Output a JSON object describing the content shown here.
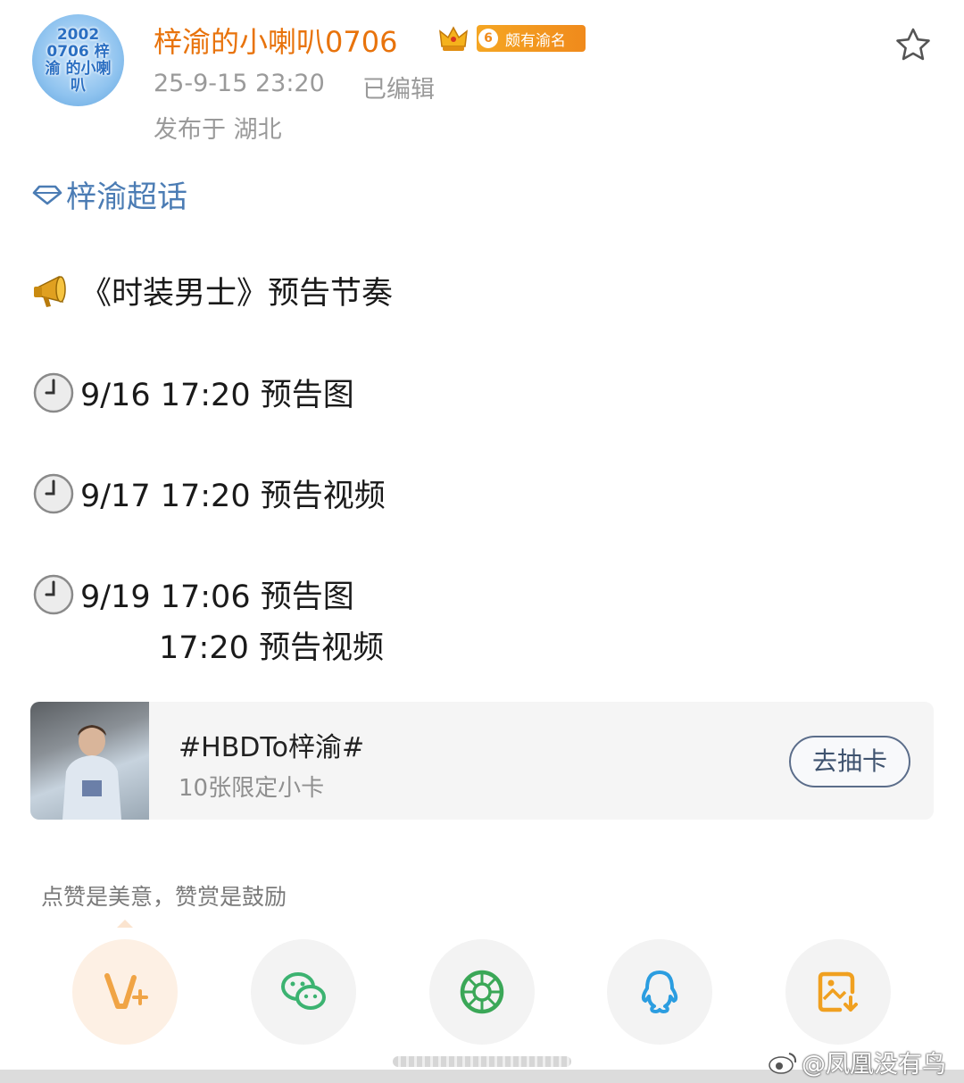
{
  "header": {
    "avatar_text": "2002 0706 梓渝 的小喇叭",
    "username": "梓渝的小喇叭0706",
    "fan_badge": {
      "level": "6",
      "name": "颇有渝名"
    },
    "time": "25-9-15 23:20",
    "edited": "已编辑",
    "location": "发布于 湖北"
  },
  "post": {
    "topic": "梓渝超话",
    "headline": "《时装男士》预告节奏",
    "schedule": [
      {
        "text": "9/16 17:20 预告图"
      },
      {
        "text": "9/17 17:20 预告视频"
      },
      {
        "text": "9/19 17:06 预告图"
      }
    ],
    "extra_line": "17:20 预告视频"
  },
  "card": {
    "title": "#HBDTo梓渝#",
    "subtitle": "10张限定小卡",
    "button": "去抽卡"
  },
  "reward_note": "点赞是美意，赞赏是鼓励",
  "share": [
    {
      "icon": "vplus-icon",
      "color": "#f0a445"
    },
    {
      "icon": "wechat-icon",
      "color": "#3cb371"
    },
    {
      "icon": "moments-icon",
      "color": "#3aa757"
    },
    {
      "icon": "qq-icon",
      "color": "#2b9de0"
    },
    {
      "icon": "save-image-icon",
      "color": "#f0a020"
    }
  ],
  "watermark": "@凤凰没有鸟",
  "colors": {
    "username": "#e8730c",
    "topic": "#4b7cb4",
    "meta": "#9a9a9a"
  }
}
